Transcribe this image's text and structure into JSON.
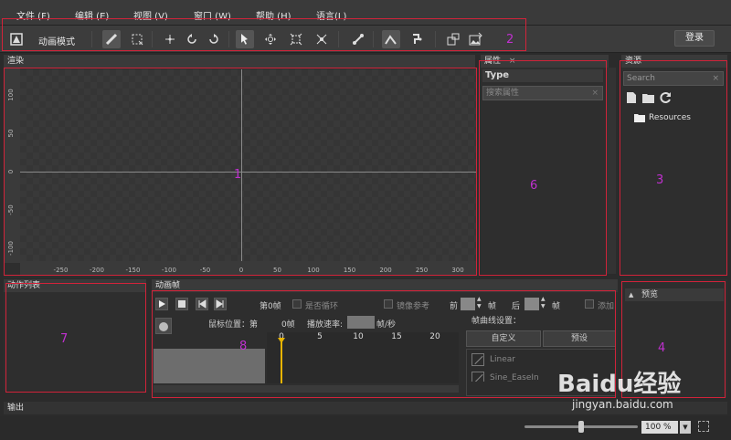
{
  "menu": {
    "file": "文件 (F)",
    "edit": "编辑 (E)",
    "view": "视图 (V)",
    "window": "窗口 (W)",
    "help": "帮助 (H)",
    "language": "语言(L)"
  },
  "toolbar": {
    "mode_label": "动画模式",
    "login_label": "登录"
  },
  "render_panel": {
    "title": "渲染",
    "x_ticks": [
      "-250",
      "-200",
      "-150",
      "-100",
      "-50",
      "0",
      "50",
      "100",
      "150",
      "200",
      "250",
      "300"
    ],
    "y_ticks": [
      "100",
      "50",
      "0",
      "-50",
      "-100"
    ]
  },
  "properties_panel": {
    "title": "属性",
    "type_label": "Type",
    "search_placeholder": "搜索属性"
  },
  "resources_panel": {
    "title": "资源",
    "search_placeholder": "Search",
    "tree_item": "Resources"
  },
  "action_list_panel": {
    "title": "动作列表"
  },
  "preview_panel": {
    "title": "预览"
  },
  "anim_frame_panel": {
    "title": "动画帧",
    "frame_label": "第0帧",
    "loop_label": "是否循环",
    "mirror_label": "镜像参考",
    "prev_label": "前",
    "frame_unit": "帧",
    "next_label": "后",
    "add_label": "添加",
    "mouse_pos_label": "鼠标位置：第",
    "mouse_pos_value": "0帧",
    "speed_label": "播放速率:",
    "speed_unit": "帧/秒",
    "curve_label": "帧曲线设置：",
    "custom_tab": "自定义",
    "preset_tab": "预设",
    "curve_linear": "Linear",
    "curve_sine": "Sine_EaseIn",
    "ruler_ticks": [
      "0",
      "5",
      "10",
      "15",
      "20"
    ]
  },
  "output_panel": {
    "title": "输出"
  },
  "status": {
    "zoom_value": "100 %",
    "zoom_level": 0.5
  },
  "annotations": [
    "1",
    "2",
    "3",
    "4",
    "6",
    "7",
    "8"
  ],
  "watermark": {
    "logo": "Baidu经验",
    "url": "jingyan.baidu.com"
  }
}
